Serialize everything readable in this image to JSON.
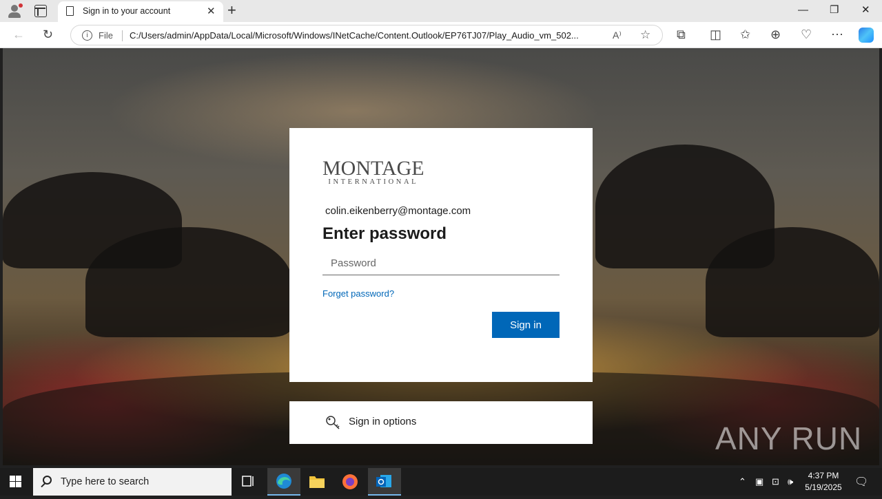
{
  "browser": {
    "tab_title": "Sign in to your account",
    "address_scheme": "File",
    "address_url": "C:/Users/admin/AppData/Local/Microsoft/Windows/INetCache/Content.Outlook/EP76TJ07/Play_Audio_vm_502..."
  },
  "login": {
    "logo_main": "MONTAGE",
    "logo_sub": "INTERNATIONAL",
    "email": "colin.eikenberry@montage.com",
    "heading": "Enter password",
    "password_placeholder": "Password",
    "forgot_link": "Forget password?",
    "signin_button": "Sign in",
    "options_label": "Sign in options"
  },
  "watermark": "ANY RUN",
  "taskbar": {
    "search_placeholder": "Type here to search",
    "time": "4:37 PM",
    "date": "5/19/2025"
  },
  "colors": {
    "accent": "#0067b8",
    "taskbar": "#1c1c1c"
  }
}
